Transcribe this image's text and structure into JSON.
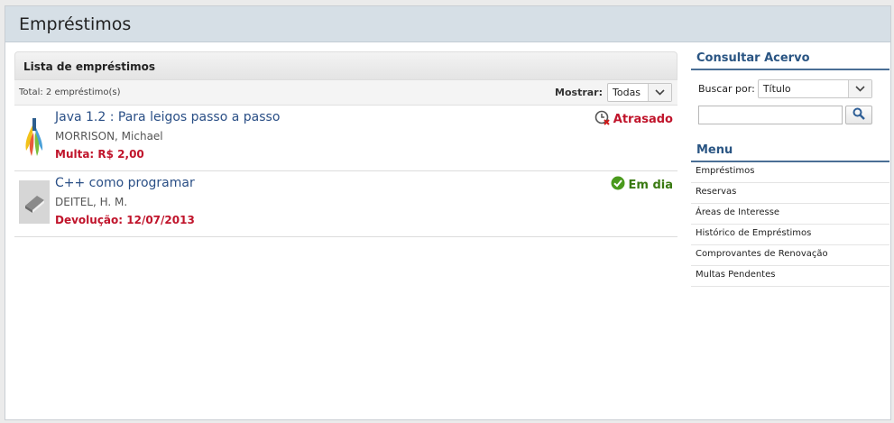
{
  "header": {
    "title": "Empréstimos"
  },
  "panel": {
    "heading": "Lista de empréstimos",
    "total": "Total: 2 empréstimo(s)",
    "filter_label": "Mostrar:",
    "filter_value": "Todas"
  },
  "loans": [
    {
      "title": "Java 1.2 : Para leigos passo a passo",
      "author": "MORRISON, Michael",
      "note": "Multa: R$ 2,00",
      "status": "Atrasado",
      "status_color": "#c0142b"
    },
    {
      "title": "C++ como programar",
      "author": "DEITEL, H. M.",
      "note": "Devolução: 12/07/2013",
      "status": "Em dia",
      "status_color": "#3a7a12"
    }
  ],
  "sidebar": {
    "consultar_title": "Consultar Acervo",
    "buscar_label": "Buscar por:",
    "buscar_value": "Título",
    "search_value": "",
    "menu_title": "Menu",
    "menu": [
      "Empréstimos",
      "Reservas",
      "Áreas de Interesse",
      "Histórico de Empréstimos",
      "Comprovantes de Renovação",
      "Multas Pendentes"
    ]
  },
  "icons": {
    "late": "clock-overdue-icon",
    "ok": "check-circle-icon",
    "search": "magnifier-icon",
    "dropdown": "chevron-down-icon"
  }
}
